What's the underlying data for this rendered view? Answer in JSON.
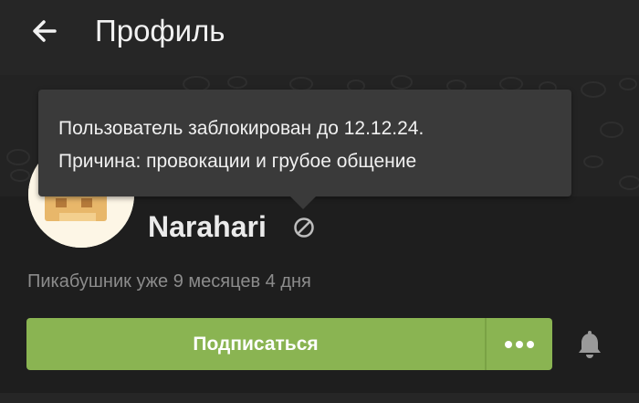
{
  "header": {
    "title": "Профиль",
    "back_icon": "arrow-left-icon"
  },
  "tooltip": {
    "line1": "Пользователь заблокирован до 12.12.24.",
    "line2": "Причина: провокации и грубое общение"
  },
  "profile": {
    "username": "Narahari",
    "status_icon": "blocked-icon",
    "membership": "Пикабушник уже 9 месяцев 4 дня"
  },
  "actions": {
    "subscribe_label": "Подписаться",
    "more_icon": "more-dots-icon",
    "bell_icon": "bell-icon"
  },
  "colors": {
    "accent": "#8ab452",
    "background": "#1e1e1e",
    "tooltip_bg": "#3a3a3a"
  }
}
